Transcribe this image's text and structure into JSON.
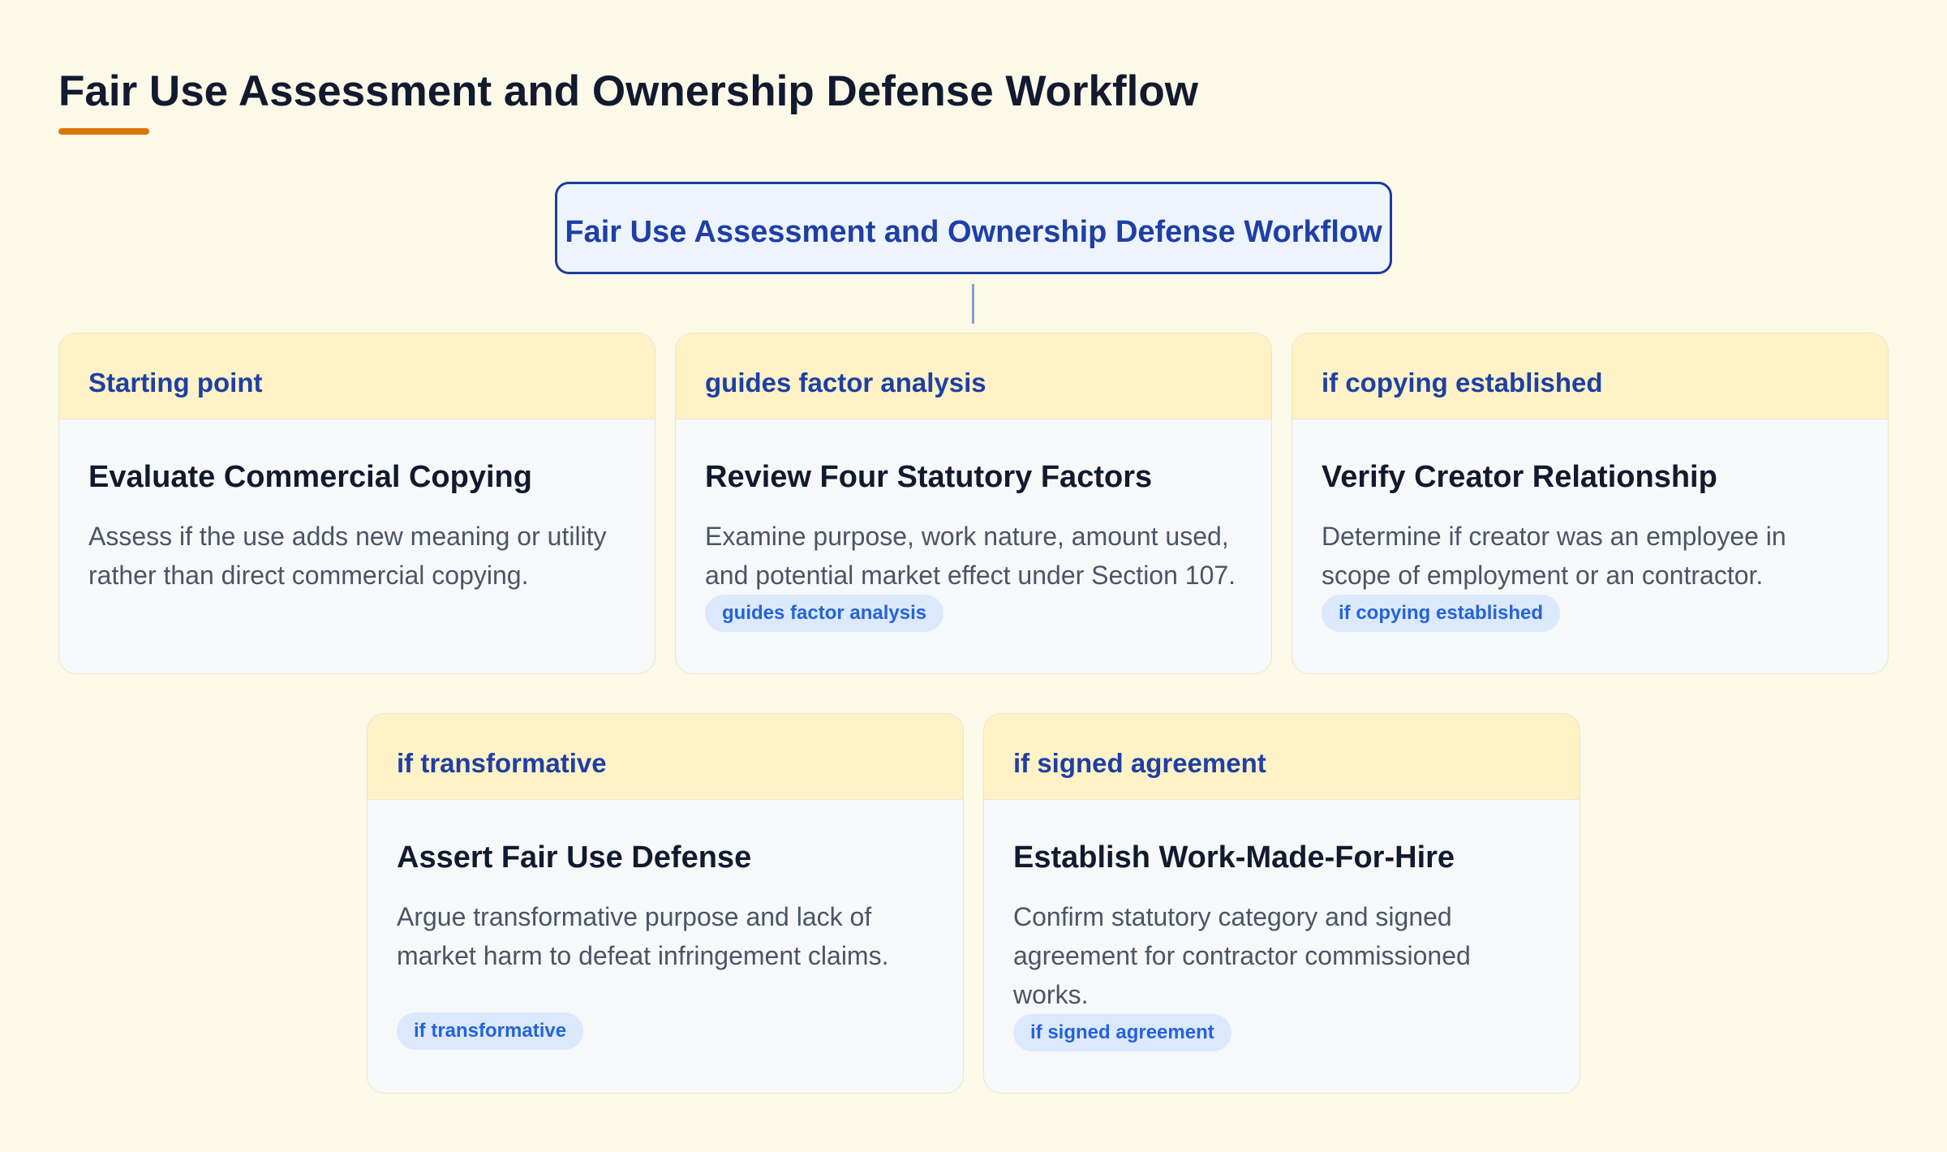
{
  "page": {
    "title": "Fair Use Assessment and Ownership Defense Workflow"
  },
  "root": {
    "label": "Fair Use Assessment and Ownership Defense Workflow"
  },
  "nodes": [
    {
      "header": "Starting point",
      "title": "Evaluate Commercial Copying",
      "description": "Assess if the use adds new meaning or utility rather than direct commercial copying.",
      "badge": ""
    },
    {
      "header": "guides factor analysis",
      "title": "Review Four Statutory Factors",
      "description": "Examine purpose, work nature, amount used, and potential market effect under Section 107.",
      "badge": "guides factor analysis"
    },
    {
      "header": "if copying established",
      "title": "Verify Creator Relationship",
      "description": "Determine if creator was an employee in scope of employment or an contractor.",
      "badge": "if copying established"
    },
    {
      "header": "if transformative",
      "title": "Assert Fair Use Defense",
      "description": "Argue transformative purpose and lack of market harm to defeat infringement claims.",
      "badge": "if transformative"
    },
    {
      "header": "if signed agreement",
      "title": "Establish Work-Made-For-Hire",
      "description": "Confirm statutory category and signed agreement for contractor commissioned works.",
      "badge": "if signed agreement"
    }
  ],
  "colors": {
    "background": "#fdf9e8",
    "accent": "#d97706",
    "root_border": "#1e3a9e",
    "header_fill": "#fef2c6",
    "badge_fill": "#dce9fc",
    "badge_text": "#2563d8"
  }
}
